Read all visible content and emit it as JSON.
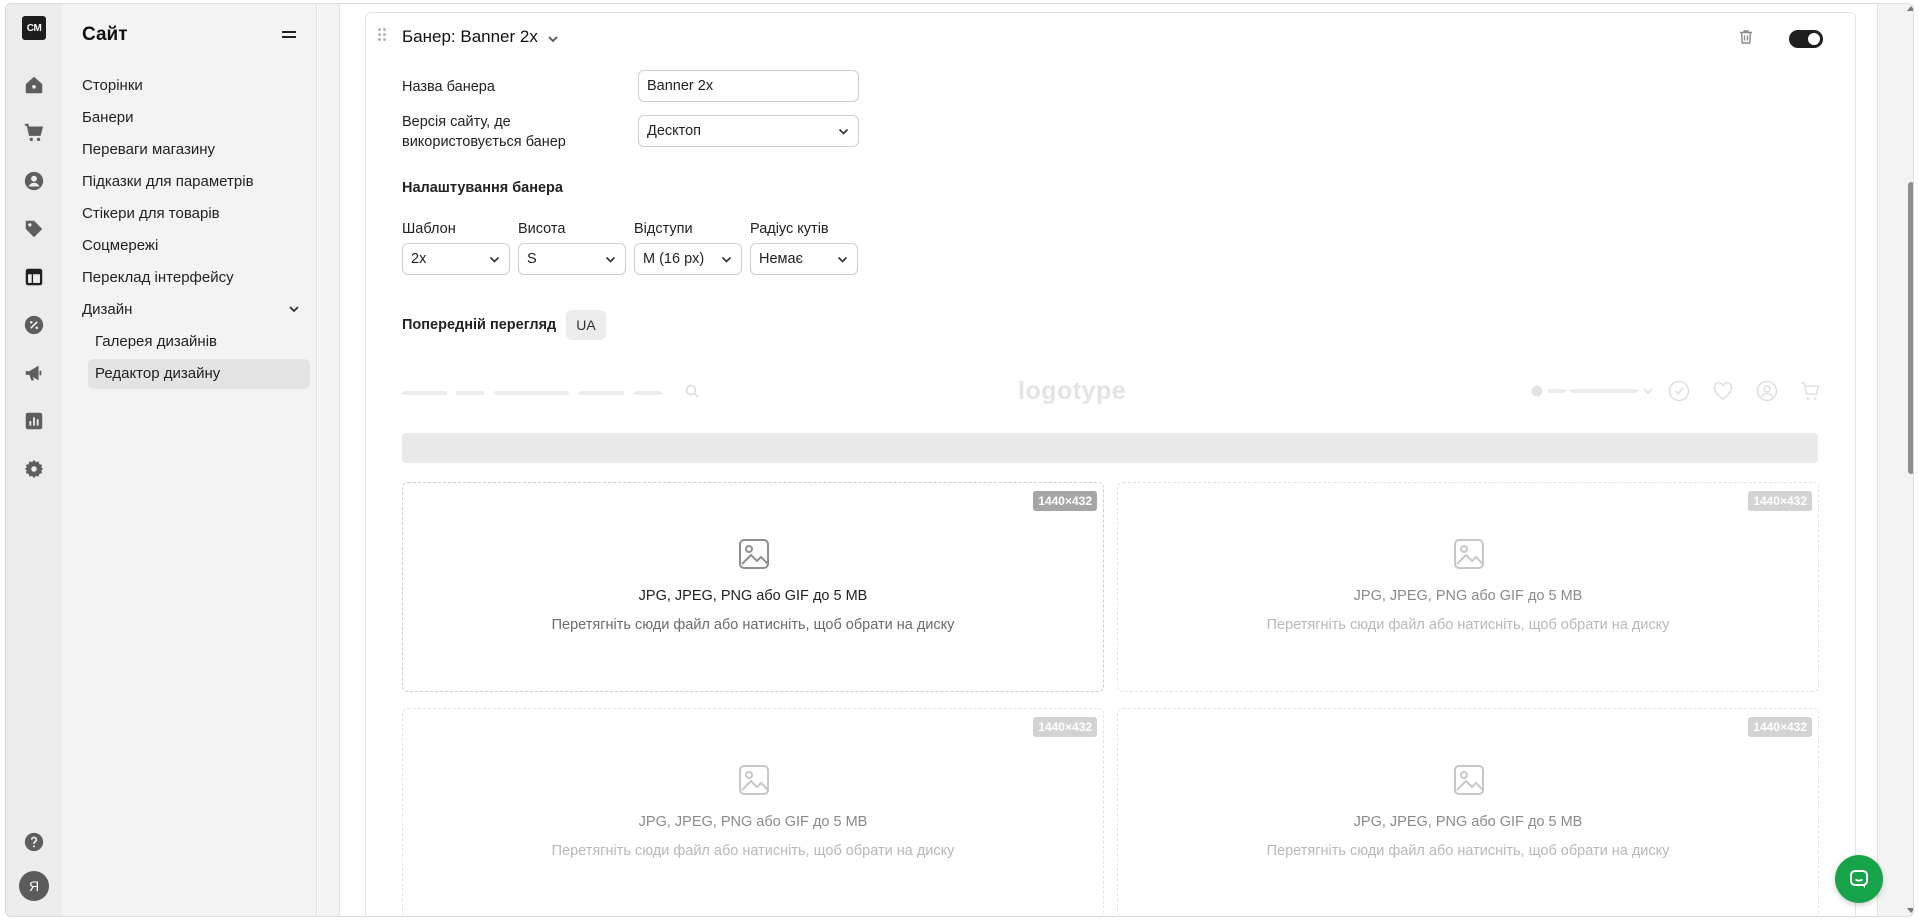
{
  "rail": {
    "logo": "CM",
    "avatar": "Я"
  },
  "sidebar": {
    "title": "Сайт",
    "items": [
      {
        "label": "Сторінки"
      },
      {
        "label": "Банери"
      },
      {
        "label": "Переваги магазину"
      },
      {
        "label": "Підказки для параметрів"
      },
      {
        "label": "Стікери для товарів"
      },
      {
        "label": "Соцмережі"
      },
      {
        "label": "Переклад інтерфейсу"
      },
      {
        "label": "Дизайн"
      }
    ],
    "subitems": [
      {
        "label": "Галерея дизайнів"
      },
      {
        "label": "Редактор дизайну"
      }
    ]
  },
  "banner": {
    "title": "Банер: Banner 2x",
    "name_label": "Назва банера",
    "name_value": "Banner 2x",
    "version_label_1": "Версія сайту, де",
    "version_label_2": "використовується банер",
    "version_value": "Десктоп",
    "settings_heading": "Налаштування банера",
    "template_label": "Шаблон",
    "template_value": "2x",
    "height_label": "Висота",
    "height_value": "S",
    "padding_label": "Відступи",
    "padding_value": "M (16 px)",
    "radius_label": "Радіус кутів",
    "radius_value": "Немає",
    "preview_label": "Попередній перегляд",
    "preview_lang": "UA"
  },
  "preview": {
    "logo_text": "logotype",
    "slots": [
      {
        "size": "1440×432",
        "formats": "JPG, JPEG, PNG або GIF до 5 MB",
        "hint": "Перетягніть сюди файл або натисніть, щоб обрати на диску"
      },
      {
        "size": "1440×432",
        "formats": "JPG, JPEG, PNG або GIF до 5 MB",
        "hint": "Перетягніть сюди файл або натисніть, щоб обрати на диску"
      },
      {
        "size": "1440×432",
        "formats": "JPG, JPEG, PNG або GIF до 5 MB",
        "hint": "Перетягніть сюди файл або натисніть, щоб обрати на диску"
      },
      {
        "size": "1440×432",
        "formats": "JPG, JPEG, PNG або GIF до 5 MB",
        "hint": "Перетягніть сюди файл або натисніть, щоб обрати на диску"
      }
    ]
  },
  "colors": {
    "accent": "#1f1f1f",
    "chat": "#16a34a",
    "sidebar_bg": "#f3f3f3",
    "rail_bg": "#ececec"
  }
}
